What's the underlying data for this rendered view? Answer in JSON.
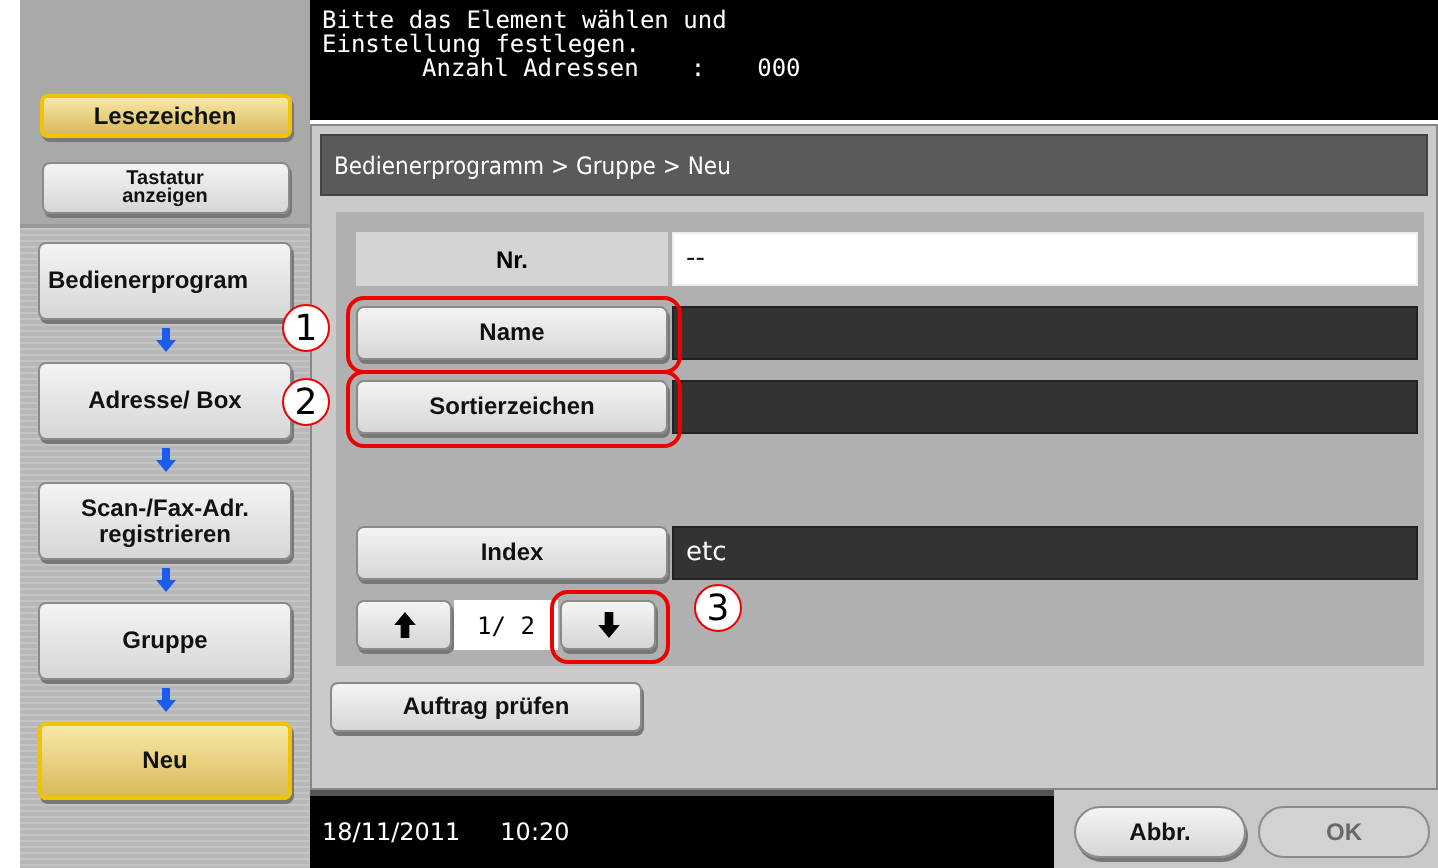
{
  "sidebar": {
    "top_buttons": [
      {
        "label": "Lesezeichen",
        "selected": true
      },
      {
        "label": "Tastatur anzeigen",
        "selected": false,
        "kind": "small"
      }
    ],
    "steps": [
      {
        "label": "Bedienerprogram",
        "selected": false
      },
      {
        "label": "Adresse/ Box",
        "selected": false
      },
      {
        "label": "Scan-/Fax-Adr. registrieren",
        "selected": false
      },
      {
        "label": "Gruppe",
        "selected": false
      },
      {
        "label": "Neu",
        "selected": true
      }
    ]
  },
  "message": {
    "lines": [
      "Bitte das Element wählen und",
      "Einstellung festlegen."
    ],
    "count_label": "Anzahl Adressen",
    "count_separator": ":",
    "count_value": "000"
  },
  "breadcrumb": "Bedienerprogramm > Gruppe > Neu",
  "fields": [
    {
      "label": "Nr.",
      "value": "--",
      "kind": "readonly"
    },
    {
      "label": "Name",
      "kind": "button",
      "callout": "1"
    },
    {
      "label": "Sortierzeichen",
      "kind": "button",
      "callout": "2"
    },
    {
      "kind": "spacer"
    },
    {
      "label": "Index",
      "value": "etc",
      "kind": "button"
    }
  ],
  "pager": {
    "page": "1/ 2",
    "down_callout": "3"
  },
  "check_button": "Auftrag prüfen",
  "status_bar": {
    "date": "18/11/2011",
    "time": "10:20"
  },
  "buttons": [
    {
      "label": "Abbr.",
      "disabled": false
    },
    {
      "label": "OK",
      "disabled": true
    }
  ]
}
